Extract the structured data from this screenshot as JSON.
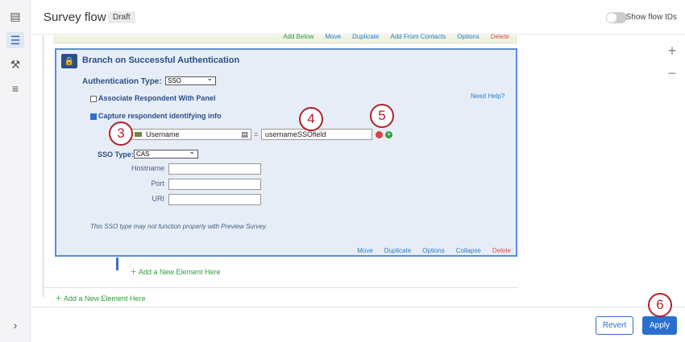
{
  "header": {
    "title": "Survey flow",
    "status": "Draft",
    "toggle_label": "Show flow IDs"
  },
  "top_block_actions": [
    "Add Below",
    "Move",
    "Duplicate",
    "Add From Contacts",
    "Options",
    "Delete"
  ],
  "branch": {
    "title": "Branch on Successful Authentication",
    "auth_type_label": "Authentication Type:",
    "auth_type_value": "SSO",
    "associate_label": "Associate Respondent With Panel",
    "associate_checked": false,
    "capture_label": "Capture respondent identifying info",
    "capture_checked": true,
    "need_help": "Need Help?",
    "field_name": "Username",
    "equals": "=",
    "field_value": "usernameSSOfield",
    "sso_type_label": "SSO Type:",
    "sso_type_value": "CAS",
    "fields": [
      {
        "label": "Hostname",
        "value": ""
      },
      {
        "label": "Port",
        "value": ""
      },
      {
        "label": "URI",
        "value": ""
      }
    ],
    "note": "This SSO type may not function properly with Preview Survey.",
    "actions": [
      "Move",
      "Duplicate",
      "Options",
      "Collapse",
      "Delete"
    ]
  },
  "add_inner": "Add a New Element Here",
  "add_outer": "Add a New Element Here",
  "callouts": [
    "3",
    "4",
    "5",
    "6"
  ],
  "footer": {
    "revert": "Revert",
    "apply": "Apply"
  },
  "colors": {
    "accent": "#2a6fd0",
    "branch_border": "#5b8dd6",
    "callout": "#b3202a",
    "add": "#2e9d3a",
    "delete": "#d9534f"
  }
}
